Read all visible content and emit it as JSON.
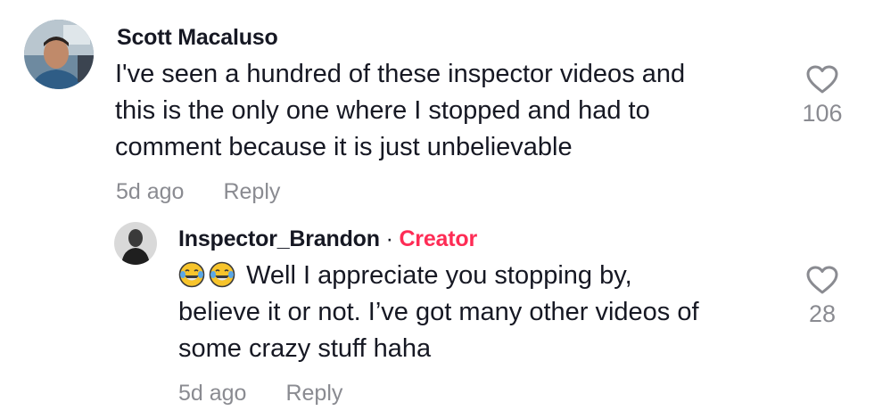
{
  "comments": [
    {
      "author": "Scott Macaluso",
      "text": "I've seen a hundred of these inspector videos and this is the only one where I stopped and had to comment because it is just unbelievable",
      "lines": [
        "I've seen a hundred of these inspector videos and",
        "this is the only one where I stopped and had to",
        "comment because it is just unbelievable"
      ],
      "time": "5d ago",
      "reply_label": "Reply",
      "likes": "106",
      "icons": {
        "like": "heart-outline-icon",
        "avatar": "user-avatar"
      }
    },
    {
      "author": "Inspector_Brandon",
      "separator": "·",
      "badge": "Creator",
      "emojis": "😂😂",
      "lines": [
        "Well I appreciate you stopping by,",
        "believe it or not. I’ve got many other videos of",
        "some crazy stuff haha"
      ],
      "time": "5d ago",
      "reply_label": "Reply",
      "likes": "28",
      "icons": {
        "like": "heart-outline-icon",
        "avatar": "user-avatar",
        "emoji": "tears-of-joy-emoji"
      }
    }
  ],
  "colors": {
    "text": "#161823",
    "muted": "#8a8b91",
    "creator": "#fe2c55"
  }
}
